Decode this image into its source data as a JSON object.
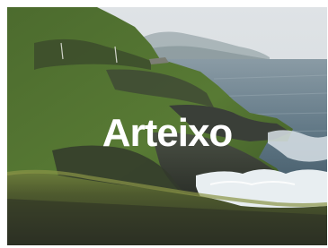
{
  "brand": {
    "name": "Arteixo",
    "text_color": "#ffffff"
  },
  "scene": {
    "description_colors": {
      "sky": "#d9dde0",
      "sea": "#5f7684",
      "cliff_green": "#4f6a32",
      "rock": "#3a3f38",
      "surf": "#e8eef1"
    }
  }
}
